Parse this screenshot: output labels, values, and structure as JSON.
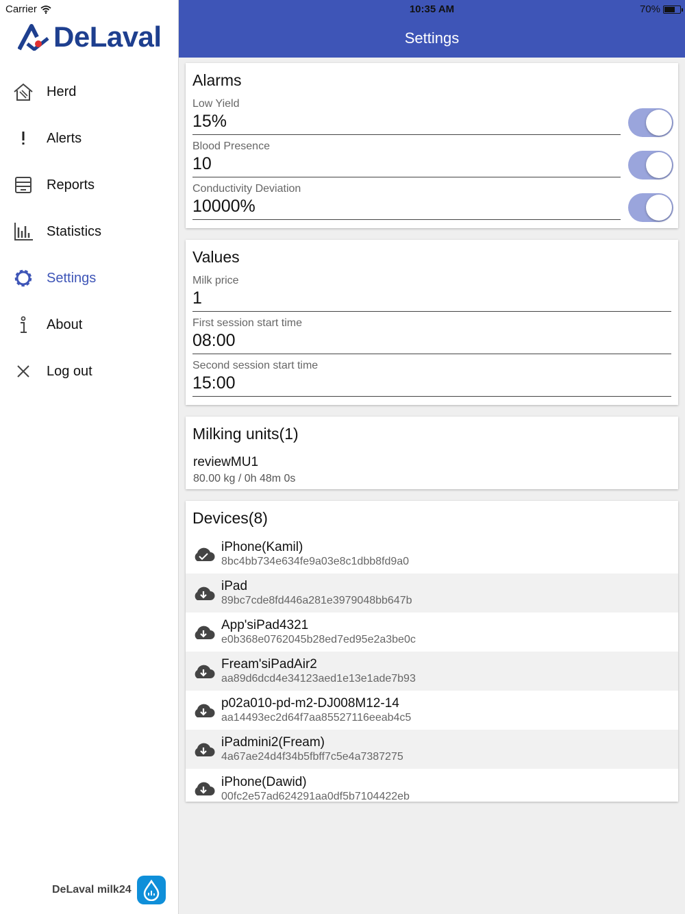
{
  "status_bar": {
    "carrier": "Carrier",
    "time": "10:35 AM",
    "battery": "70%"
  },
  "sidebar": {
    "logo": "DeLaval",
    "items": [
      {
        "label": "Herd",
        "icon": "herd-icon"
      },
      {
        "label": "Alerts",
        "icon": "exclamation-icon"
      },
      {
        "label": "Reports",
        "icon": "reports-icon"
      },
      {
        "label": "Statistics",
        "icon": "statistics-icon"
      },
      {
        "label": "Settings",
        "icon": "gear-icon",
        "active": true
      },
      {
        "label": "About",
        "icon": "info-icon"
      },
      {
        "label": "Log out",
        "icon": "close-icon"
      }
    ],
    "footer": "DeLaval milk24"
  },
  "header": {
    "title": "Settings"
  },
  "alarms": {
    "title": "Alarms",
    "fields": [
      {
        "label": "Low Yield",
        "value": "15%",
        "enabled": true
      },
      {
        "label": "Blood Presence",
        "value": "10",
        "enabled": true
      },
      {
        "label": "Conductivity Deviation",
        "value": "10000%",
        "enabled": true
      }
    ]
  },
  "values": {
    "title": "Values",
    "fields": [
      {
        "label": "Milk price",
        "value": "1"
      },
      {
        "label": "First session start time",
        "value": "08:00"
      },
      {
        "label": "Second session start time",
        "value": "15:00"
      }
    ]
  },
  "milking_units": {
    "title": "Milking units(1)",
    "items": [
      {
        "name": "reviewMU1",
        "meta": "80.00 kg / 0h 48m 0s"
      }
    ]
  },
  "devices": {
    "title": "Devices(8)",
    "items": [
      {
        "name": "iPhone(Kamil)",
        "id": "8bc4bb734e634fe9a03e8c1dbb8fd9a0",
        "icon": "cloud-check-icon"
      },
      {
        "name": "iPad",
        "id": "89bc7cde8fd446a281e3979048bb647b",
        "icon": "cloud-download-icon"
      },
      {
        "name": "App'siPad4321",
        "id": "e0b368e0762045b28ed7ed95e2a3be0c",
        "icon": "cloud-download-icon"
      },
      {
        "name": "Fream'siPadAir2",
        "id": "aa89d6dcd4e34123aed1e13e1ade7b93",
        "icon": "cloud-download-icon"
      },
      {
        "name": "p02a010-pd-m2-DJ008M12-14",
        "id": "aa14493ec2d64f7aa85527116eeab4c5",
        "icon": "cloud-download-icon"
      },
      {
        "name": "iPadmini2(Fream)",
        "id": "4a67ae24d4f34b5fbff7c5e4a7387275",
        "icon": "cloud-download-icon"
      },
      {
        "name": "iPhone(Dawid)",
        "id": "00fc2e57ad624291aa0df5b7104422eb",
        "icon": "cloud-download-icon"
      }
    ]
  }
}
